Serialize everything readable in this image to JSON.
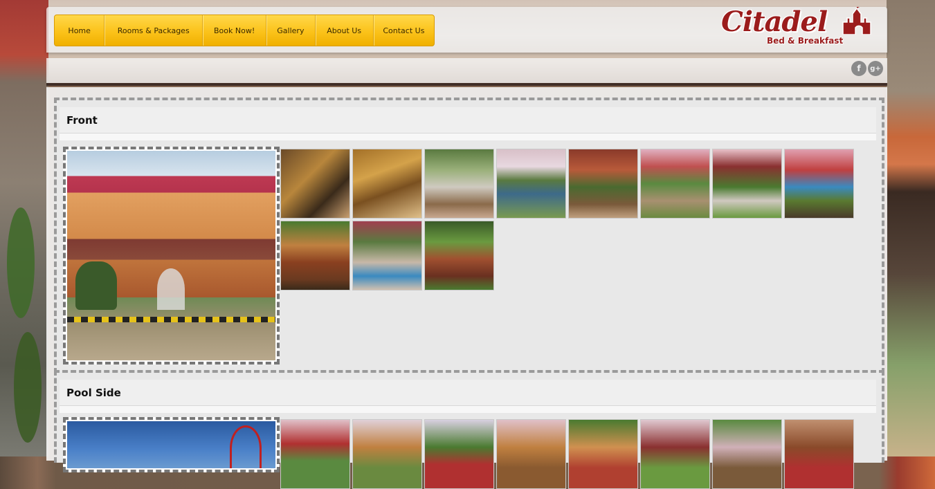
{
  "nav": {
    "items": [
      {
        "label": "Home",
        "width": 72
      },
      {
        "label": "Rooms & Packages",
        "width": 142
      },
      {
        "label": "Book Now!",
        "width": 92
      },
      {
        "label": "Gallery",
        "width": 70
      },
      {
        "label": "About Us",
        "width": 84
      },
      {
        "label": "Contact Us",
        "width": 88
      }
    ]
  },
  "logo": {
    "name": "Citadel",
    "tagline": "Bed & Breakfast"
  },
  "social": [
    {
      "label": "f",
      "icon": "facebook-icon"
    },
    {
      "label": "g+",
      "icon": "google-plus-icon"
    }
  ],
  "gallery": {
    "sections": [
      {
        "title": "Front",
        "main_photo": "front-building",
        "thumbnails": [
          "lobby-lounge",
          "reception-desk",
          "garden-umbrella",
          "garden-pool",
          "sign-entrance",
          "walkway-tables",
          "garden-tables",
          "pool-plants",
          "wooden-deck",
          "pool-corner",
          "wooden-stairs"
        ]
      },
      {
        "title": "Pool Side",
        "main_photo": "pool-sky",
        "thumbnails": [
          "red-roof-hut",
          "tower-hut",
          "garden-huts",
          "tower-walkway",
          "palm-shade",
          "red-roof-cottage",
          "walkway-garden",
          "wall-decor"
        ]
      }
    ]
  }
}
